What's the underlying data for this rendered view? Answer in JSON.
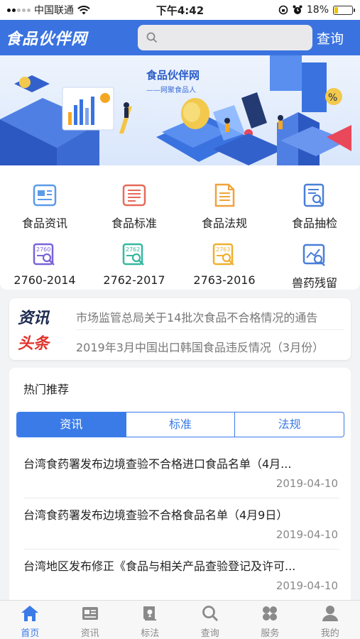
{
  "status_bar": {
    "carrier": "中国联通",
    "time": "下午4:42",
    "battery": "18%"
  },
  "header": {
    "logo": "食品伙伴网",
    "search_placeholder": "",
    "query_button": "查询"
  },
  "banner": {
    "title": "食品伙伴网",
    "subtitle": "——网聚食品人"
  },
  "categories": [
    {
      "label": "食品资讯",
      "icon": "news-doc-icon"
    },
    {
      "label": "食品标准",
      "icon": "standard-doc-icon"
    },
    {
      "label": "食品法规",
      "icon": "law-doc-icon"
    },
    {
      "label": "食品抽检",
      "icon": "inspection-doc-icon"
    },
    {
      "label": "2760-2014",
      "icon": "search-doc-icon",
      "badge": "2760"
    },
    {
      "label": "2762-2017",
      "icon": "search-doc-icon",
      "badge": "2762"
    },
    {
      "label": "2763-2016",
      "icon": "search-doc-icon",
      "badge": "2763"
    },
    {
      "label": "兽药残留",
      "icon": "chart-search-icon"
    }
  ],
  "headline": {
    "logo_top": "资讯",
    "logo_bottom": "头条",
    "items": [
      "市场监管总局关于14批次食品不合格情况的通告",
      "2019年3月中国出口韩国食品违反情况（3月份）"
    ]
  },
  "hot": {
    "title": "热门推荐",
    "tabs": [
      "资讯",
      "标准",
      "法规"
    ],
    "active_tab": 0,
    "news": [
      {
        "title": "台湾食药署发布边境查验不合格进口食品名单（4月...",
        "date": "2019-04-10"
      },
      {
        "title": "台湾食药署发布边境查验不合格食品名单（4月9日）",
        "date": "2019-04-10"
      },
      {
        "title": "台湾地区发布修正《食品与相关产品查验登记及许可...",
        "date": "2019-04-10"
      }
    ]
  },
  "tabbar": [
    {
      "label": "首页",
      "icon": "home-icon",
      "active": true
    },
    {
      "label": "资讯",
      "icon": "news-card-icon"
    },
    {
      "label": "标法",
      "icon": "book-icon"
    },
    {
      "label": "查询",
      "icon": "search-icon"
    },
    {
      "label": "服务",
      "icon": "grid-service-icon"
    },
    {
      "label": "我的",
      "icon": "user-icon"
    }
  ],
  "colors": {
    "brand": "#3a73e0",
    "accent": "#3a7be8",
    "headline_red": "#e0332b"
  }
}
